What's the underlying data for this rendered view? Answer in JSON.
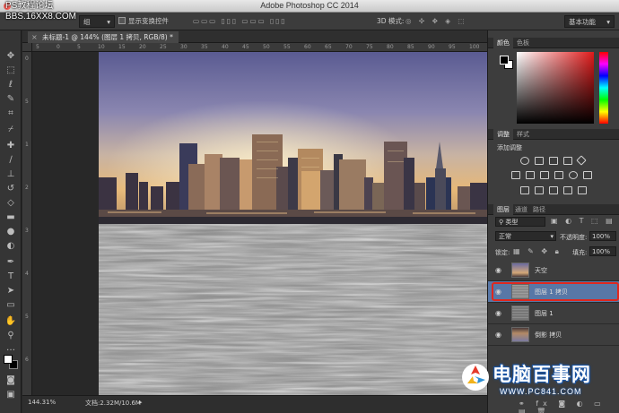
{
  "window": {
    "title": "Adobe Photoshop CC 2014",
    "watermark_line1": "PS教程论坛",
    "watermark_line2": "BBS.16XX8.COM"
  },
  "options_bar": {
    "tool_dropdown": "组",
    "show_transform_label": "显示变换控件",
    "mode_3d_label": "3D 模式:",
    "workspace": "基本功能"
  },
  "document": {
    "tab_label": "未标题-1 @ 144% (图层 1 拷贝, RGB/8) *",
    "zoom": "144.31%",
    "doc_size": "文档:2.32M/10.6M",
    "ruler_top_ticks": [
      "5",
      "0",
      "5",
      "10",
      "15",
      "20",
      "25",
      "30",
      "35",
      "40",
      "45",
      "50",
      "55",
      "60",
      "65",
      "70",
      "75",
      "80",
      "85",
      "90",
      "95",
      "100"
    ],
    "ruler_left_ticks": [
      "0",
      "5",
      "1",
      "2",
      "3",
      "4",
      "5",
      "6"
    ]
  },
  "color_panel": {
    "tabs": [
      "颜色",
      "色板"
    ]
  },
  "adjust_panel": {
    "tabs": [
      "调整",
      "样式"
    ],
    "heading": "添加调整"
  },
  "layers_panel": {
    "tabs": [
      "图层",
      "通道",
      "路径"
    ],
    "filter_kind": "类型",
    "blend_mode": "正常",
    "opacity_label": "不透明度:",
    "opacity_value": "100%",
    "lock_label": "锁定:",
    "fill_label": "填充:",
    "fill_value": "100%",
    "layers": [
      {
        "name": "天空",
        "selected": false
      },
      {
        "name": "图层 1 拷贝",
        "selected": true
      },
      {
        "name": "图层 1",
        "selected": false
      },
      {
        "name": "倒影 拷贝",
        "selected": false
      }
    ]
  },
  "brand_watermark": {
    "name": "电脑百事网",
    "url": "WWW.PC841.COM"
  },
  "colors": {
    "selection_highlight": "#5877a6",
    "callout_red": "#e0271d",
    "brand_blue": "#1a56a8"
  }
}
